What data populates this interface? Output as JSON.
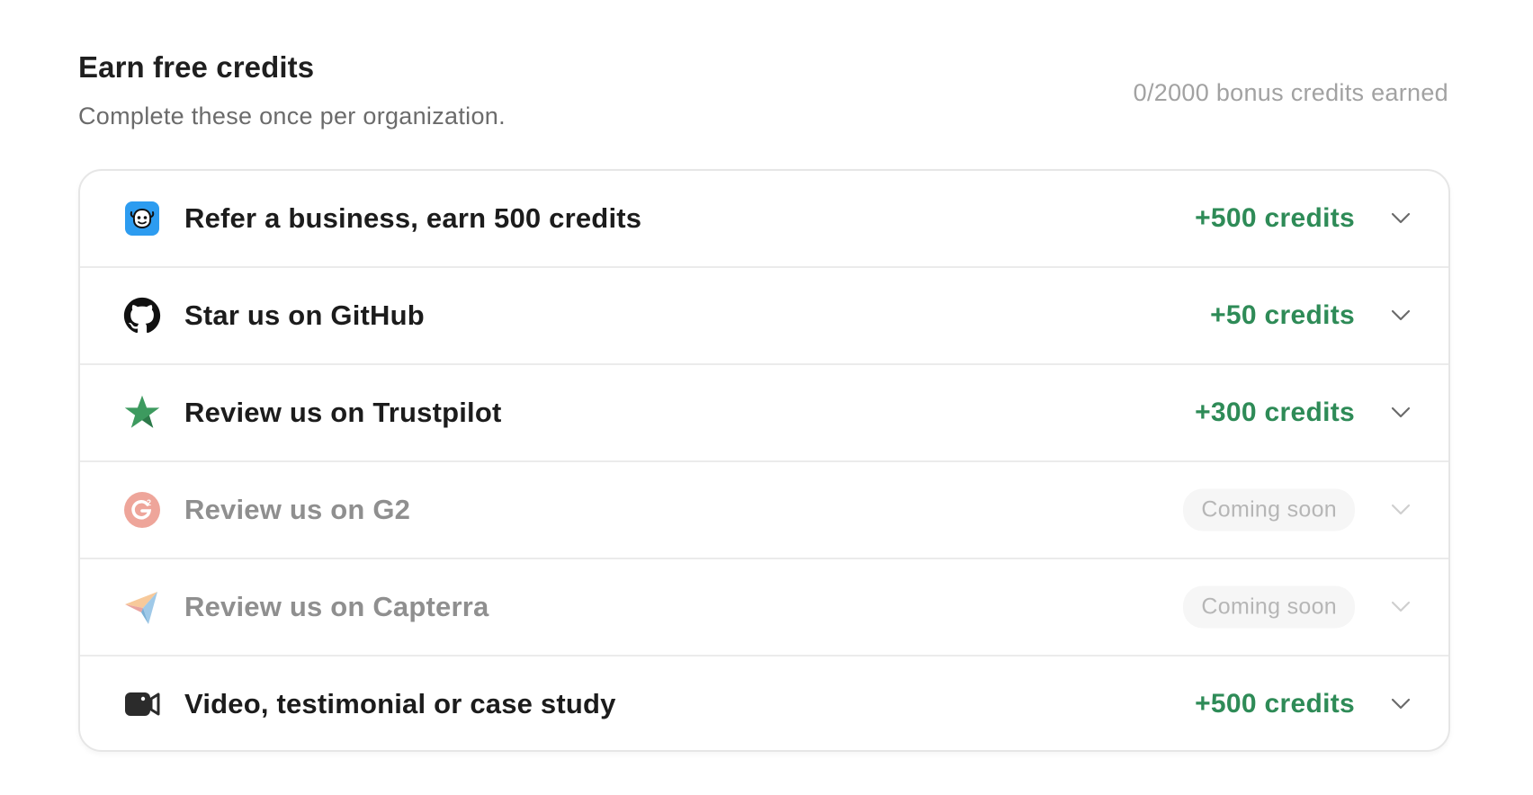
{
  "header": {
    "title": "Earn free credits",
    "subtitle": "Complete these once per organization.",
    "progress": "0/2000 bonus credits earned"
  },
  "colors": {
    "accent_green": "#2e8b57",
    "muted_text": "#8f8f8f",
    "badge_bg": "#f6f6f6"
  },
  "rows": [
    {
      "icon": "referral-app-icon",
      "label": "Refer a business, earn 500 credits",
      "reward": "+500 credits",
      "status": "available"
    },
    {
      "icon": "github-icon",
      "label": "Star us on GitHub",
      "reward": "+50 credits",
      "status": "available"
    },
    {
      "icon": "trustpilot-star-icon",
      "label": "Review us on Trustpilot",
      "reward": "+300 credits",
      "status": "available"
    },
    {
      "icon": "g2-icon",
      "label": "Review us on G2",
      "badge": "Coming soon",
      "status": "coming-soon"
    },
    {
      "icon": "capterra-icon",
      "label": "Review us on Capterra",
      "badge": "Coming soon",
      "status": "coming-soon"
    },
    {
      "icon": "video-camera-icon",
      "label": "Video, testimonial or case study",
      "reward": "+500 credits",
      "status": "available"
    }
  ]
}
